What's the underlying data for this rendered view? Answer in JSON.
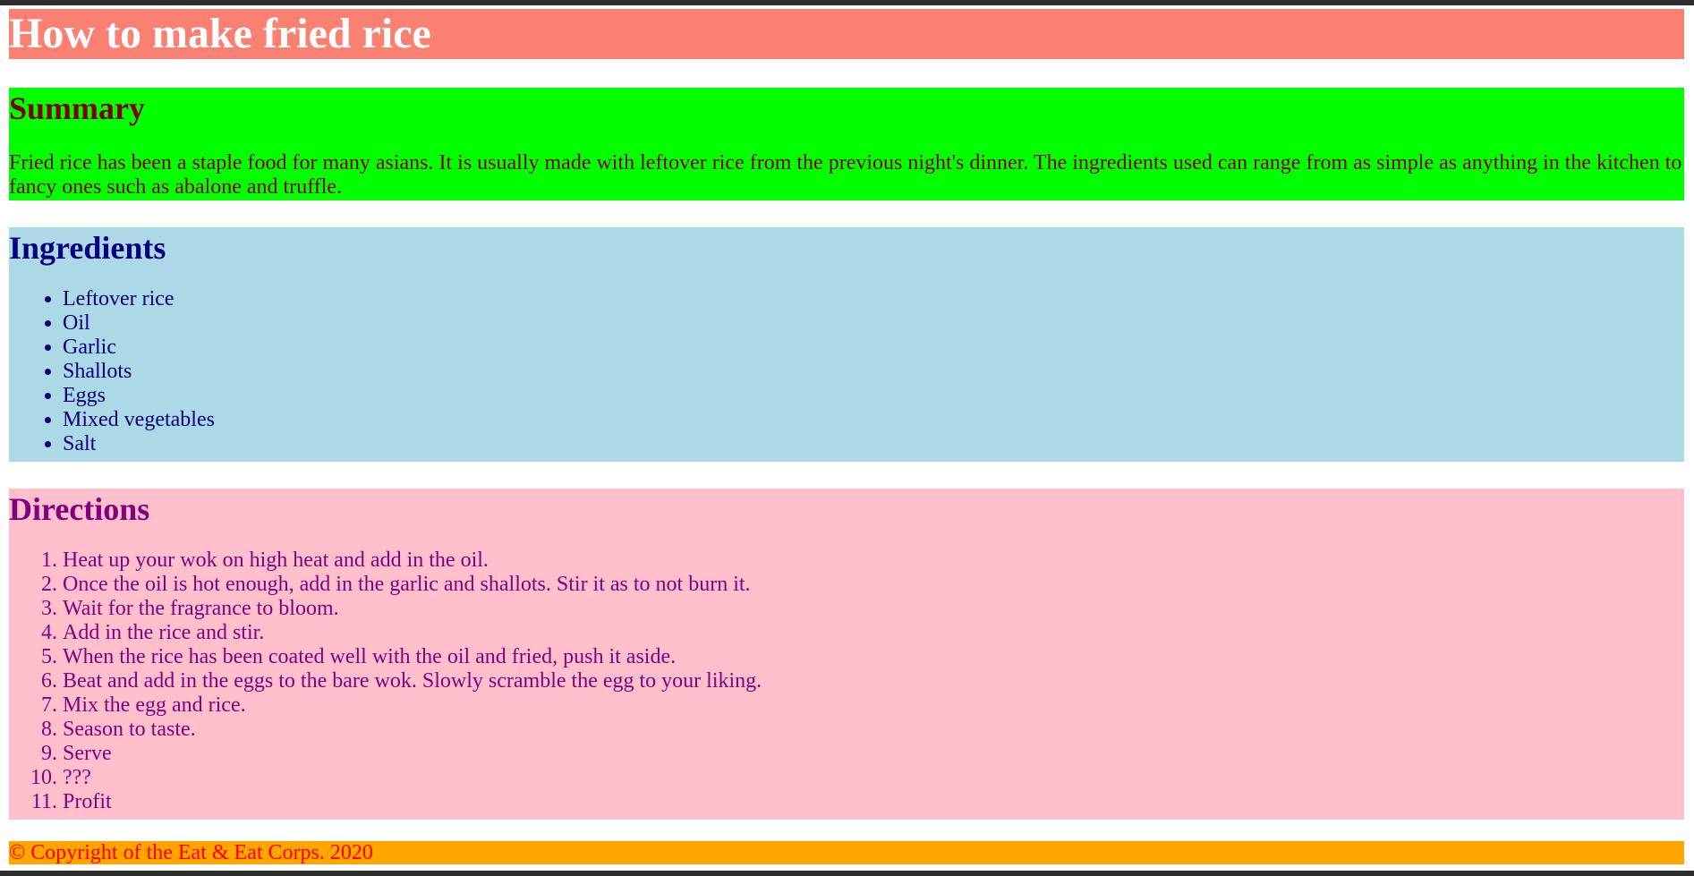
{
  "header": {
    "title": "How to make fried rice"
  },
  "summary": {
    "heading": "Summary",
    "text": "Fried rice has been a staple food for many asians. It is usually made with leftover rice from the previous night's dinner. The ingredients used can range from as simple as anything in the kitchen to fancy ones such as abalone and truffle."
  },
  "ingredients": {
    "heading": "Ingredients",
    "items": [
      "Leftover rice",
      "Oil",
      "Garlic",
      "Shallots",
      "Eggs",
      "Mixed vegetables",
      "Salt"
    ]
  },
  "directions": {
    "heading": "Directions",
    "steps": [
      "Heat up your wok on high heat and add in the oil.",
      "Once the oil is hot enough, add in the garlic and shallots. Stir it as to not burn it.",
      "Wait for the fragrance to bloom.",
      "Add in the rice and stir.",
      "When the rice has been coated well with the oil and fried, push it aside.",
      "Beat and add in the eggs to the bare wok. Slowly scramble the egg to your liking.",
      "Mix the egg and rice.",
      "Season to taste.",
      "Serve",
      "???",
      "Profit"
    ]
  },
  "footer": {
    "copyright": "© Copyright of the Eat & Eat Corps. 2020"
  },
  "colors": {
    "title_bg": "#fa8072",
    "summary_bg": "#00ff00",
    "ingredients_bg": "#add8e6",
    "directions_bg": "#ffc0cb",
    "footer_bg": "#ffa500"
  }
}
